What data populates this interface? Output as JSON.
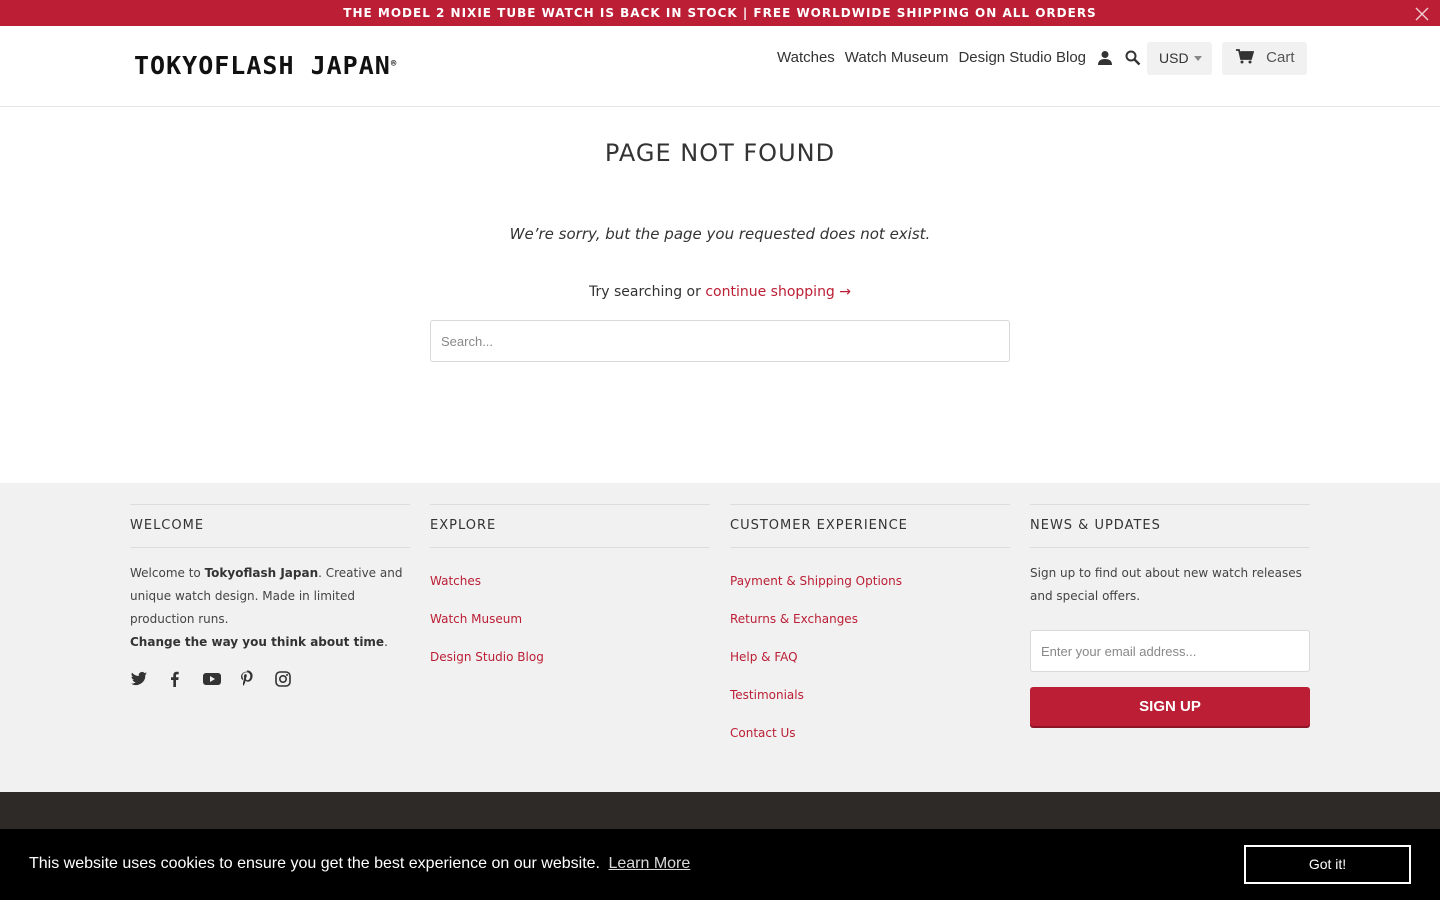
{
  "announcement": {
    "text": "THE MODEL 2 NIXIE TUBE WATCH IS BACK IN STOCK | FREE WORLDWIDE SHIPPING ON ALL ORDERS",
    "close_icon": "close-icon"
  },
  "header": {
    "logo_text": "TOKYOFLASH JAPAN",
    "logo_mark": "®",
    "nav": [
      {
        "label": "Watches"
      },
      {
        "label": "Watch Museum"
      },
      {
        "label": "Design Studio Blog"
      }
    ],
    "account_icon": "user-icon",
    "search_icon": "search-icon",
    "currency": "USD",
    "cart_label": "Cart",
    "cart_icon": "cart-icon"
  },
  "main": {
    "title": "PAGE NOT FOUND",
    "sorry": "We’re sorry, but the page you requested does not exist.",
    "try_text": "Try searching or ",
    "continue_link": "continue shopping →",
    "search_placeholder": "Search..."
  },
  "footer": {
    "welcome": {
      "title": "WELCOME",
      "pre": "Welcome to ",
      "brand": "Tokyoflash Japan",
      "post": ". Creative and unique watch design. Made in limited production runs.",
      "tagline": "Change the way you think about time",
      "tagline_end": ".",
      "social": [
        "twitter-icon",
        "facebook-icon",
        "youtube-icon",
        "pinterest-icon",
        "instagram-icon"
      ]
    },
    "explore": {
      "title": "EXPLORE",
      "links": [
        "Watches",
        "Watch Museum",
        "Design Studio Blog"
      ]
    },
    "customer": {
      "title": "CUSTOMER EXPERIENCE",
      "links": [
        "Payment & Shipping Options",
        "Returns & Exchanges",
        "Help & FAQ",
        "Testimonials",
        "Contact Us"
      ]
    },
    "news": {
      "title": "NEWS & UPDATES",
      "text": "Sign up to find out about new watch releases and special offers.",
      "email_placeholder": "Enter your email address...",
      "signup_label": "SIGN UP"
    }
  },
  "cookie": {
    "message": "This website uses cookies to ensure you get the best experience on our website.",
    "learn_more": "Learn More",
    "accept": "Got it!"
  },
  "colors": {
    "brand": "#bb1e35",
    "footer_bg": "#f1f1f1",
    "bottom_bar": "#2e2a28"
  }
}
